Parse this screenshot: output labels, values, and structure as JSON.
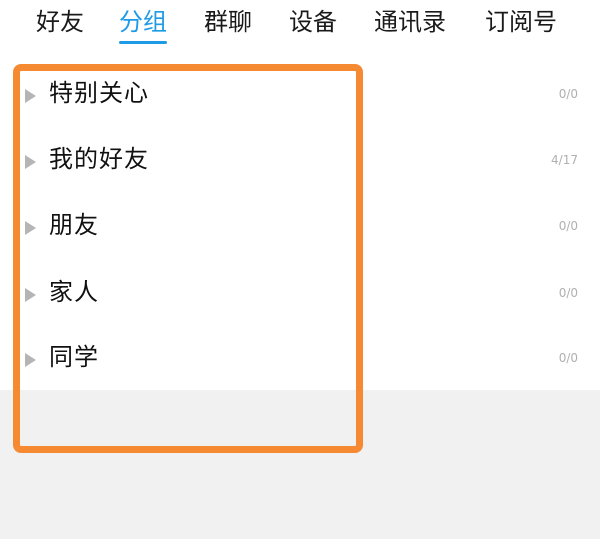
{
  "tabs": [
    {
      "label": "好友",
      "active": false
    },
    {
      "label": "分组",
      "active": true
    },
    {
      "label": "群聊",
      "active": false
    },
    {
      "label": "设备",
      "active": false
    },
    {
      "label": "通讯录",
      "active": false
    },
    {
      "label": "订阅号",
      "active": false
    }
  ],
  "groups": [
    {
      "name": "特别关心",
      "count": "0/0"
    },
    {
      "name": "我的好友",
      "count": "4/17"
    },
    {
      "name": "朋友",
      "count": "0/0"
    },
    {
      "name": "家人",
      "count": "0/0"
    },
    {
      "name": "同学",
      "count": "0/0"
    }
  ],
  "colors": {
    "accent": "#1e9be6",
    "highlight": "#f58a33",
    "count_text": "#b0b0b0",
    "background": "#f1f1f1"
  },
  "icons": {
    "row_expand": "triangle-right-icon"
  }
}
